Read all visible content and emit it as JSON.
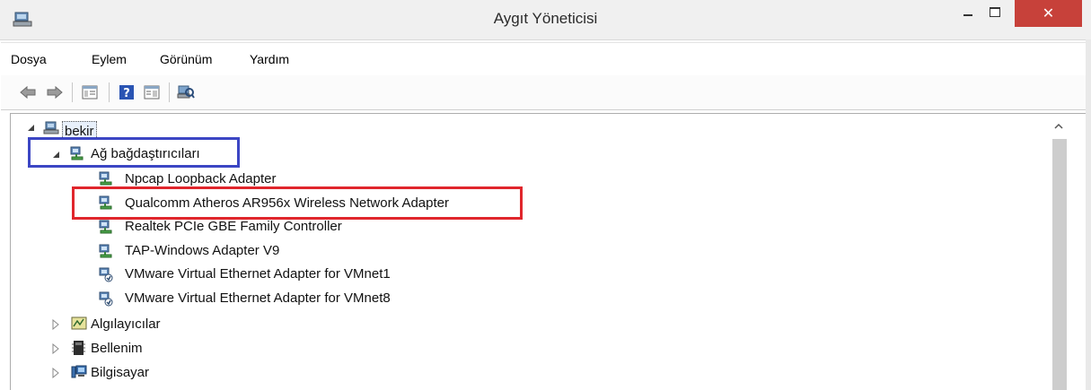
{
  "window": {
    "title": "Aygıt Yöneticisi",
    "close_glyph": "✕"
  },
  "menu": [
    "Dosya",
    "Eylem",
    "Görünüm",
    "Yardım"
  ],
  "toolbar_icons": [
    "back-arrow-icon",
    "forward-arrow-icon",
    "properties-icon",
    "help-icon",
    "details-icon",
    "scan-hardware-icon"
  ],
  "tree": {
    "root": "bekir",
    "network_category": "Ağ bağdaştırıcıları",
    "network_adapters": [
      "Npcap Loopback Adapter",
      "Qualcomm Atheros AR956x Wireless Network Adapter",
      "Realtek PCIe GBE Family Controller",
      "TAP-Windows Adapter V9",
      "VMware Virtual Ethernet Adapter for VMnet1",
      "VMware Virtual Ethernet Adapter for VMnet8"
    ],
    "other_categories": [
      "Algılayıcılar",
      "Bellenim",
      "Bilgisayar"
    ]
  },
  "colors": {
    "highlight_blue": "#3c46c4",
    "highlight_red": "#e0262c",
    "close_button": "#c7413a"
  }
}
